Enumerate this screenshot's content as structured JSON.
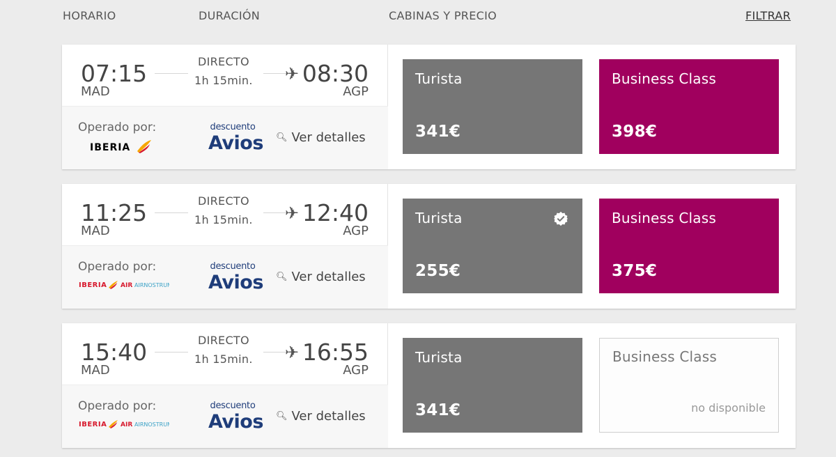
{
  "header": {
    "horario": "HORARIO",
    "duracion": "DURACIÓN",
    "cabinas": "CABINAS Y PRECIO",
    "filtrar": "FILTRAR"
  },
  "flights": [
    {
      "departure_time": "07:15",
      "departure_code": "MAD",
      "arrival_time": "08:30",
      "arrival_code": "AGP",
      "stops": "DIRECTO",
      "duration": "1h 15min.",
      "operated_label": "Operado por:",
      "operator": "IBERIA",
      "operator_partner": "",
      "discount_small": "descuento",
      "discount_big": "Avios",
      "details_label": "Ver detalles",
      "turista_label": "Turista",
      "turista_price": "341€",
      "turista_selected": false,
      "business_label": "Business Class",
      "business_price": "398€",
      "business_available": true,
      "business_na": ""
    },
    {
      "departure_time": "11:25",
      "departure_code": "MAD",
      "arrival_time": "12:40",
      "arrival_code": "AGP",
      "stops": "DIRECTO",
      "duration": "1h 15min.",
      "operated_label": "Operado por:",
      "operator": "IBERIA",
      "operator_partner": "AIRNOSTRUM",
      "discount_small": "descuento",
      "discount_big": "Avios",
      "details_label": "Ver detalles",
      "turista_label": "Turista",
      "turista_price": "255€",
      "turista_selected": true,
      "business_label": "Business Class",
      "business_price": "375€",
      "business_available": true,
      "business_na": ""
    },
    {
      "departure_time": "15:40",
      "departure_code": "MAD",
      "arrival_time": "16:55",
      "arrival_code": "AGP",
      "stops": "DIRECTO",
      "duration": "1h 15min.",
      "operated_label": "Operado por:",
      "operator": "IBERIA",
      "operator_partner": "AIRNOSTRUM",
      "discount_small": "descuento",
      "discount_big": "Avios",
      "details_label": "Ver detalles",
      "turista_label": "Turista",
      "turista_price": "341€",
      "turista_selected": false,
      "business_label": "Business Class",
      "business_price": "",
      "business_available": false,
      "business_na": "no disponible"
    }
  ],
  "colors": {
    "turista": "#767676",
    "business": "#a0005e",
    "iberia_red": "#d7192d",
    "avios_blue": "#1f3d7a"
  }
}
